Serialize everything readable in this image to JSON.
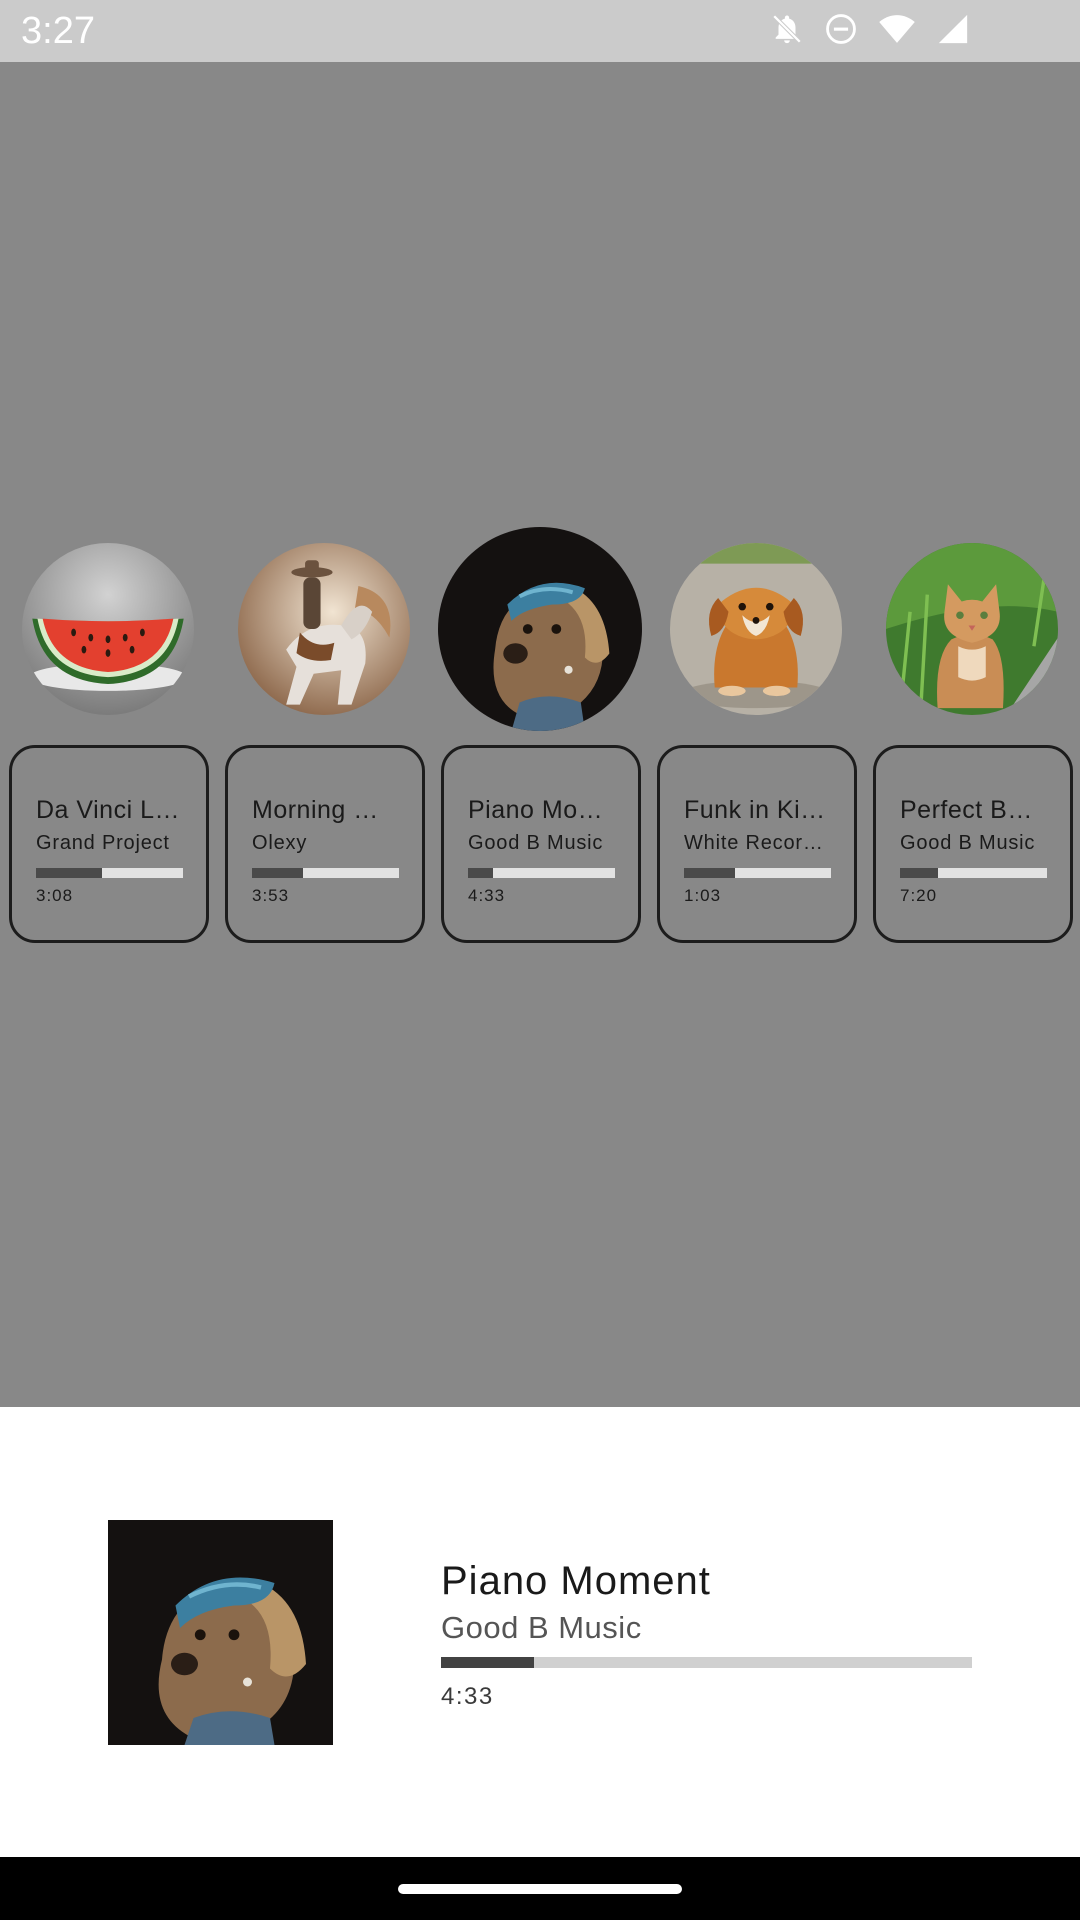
{
  "status_bar": {
    "time": "3:27",
    "icons": [
      "notifications-off-icon",
      "do-not-disturb-icon",
      "wifi-icon",
      "cell-signal-icon"
    ]
  },
  "tracks": [
    {
      "title": "Da Vinci L…",
      "artist": "Grand Project",
      "duration": "3:08",
      "progress": 0.45,
      "art": "watermelon-art"
    },
    {
      "title": "Morning …",
      "artist": "Olexy",
      "duration": "3:53",
      "progress": 0.35,
      "art": "cowboy-horse-art"
    },
    {
      "title": "Piano Mo…",
      "artist": "Good B Music",
      "duration": "4:33",
      "progress": 0.17,
      "art": "dog-portrait-art",
      "selected": true
    },
    {
      "title": "Funk in Ki…",
      "artist": "White Recor…",
      "duration": "1:03",
      "progress": 0.35,
      "art": "small-dog-art"
    },
    {
      "title": "Perfect B…",
      "artist": "Good B Music",
      "duration": "7:20",
      "progress": 0.26,
      "art": "cat-art"
    }
  ],
  "now_playing": {
    "title": "Piano Moment",
    "artist": "Good B Music",
    "duration": "4:33",
    "progress": 0.175,
    "art": "dog-portrait-art"
  },
  "colors": {
    "background": "#888888",
    "panel": "#ffffff",
    "progress_fill": "#424242",
    "progress_track": "#d0d0d0"
  }
}
